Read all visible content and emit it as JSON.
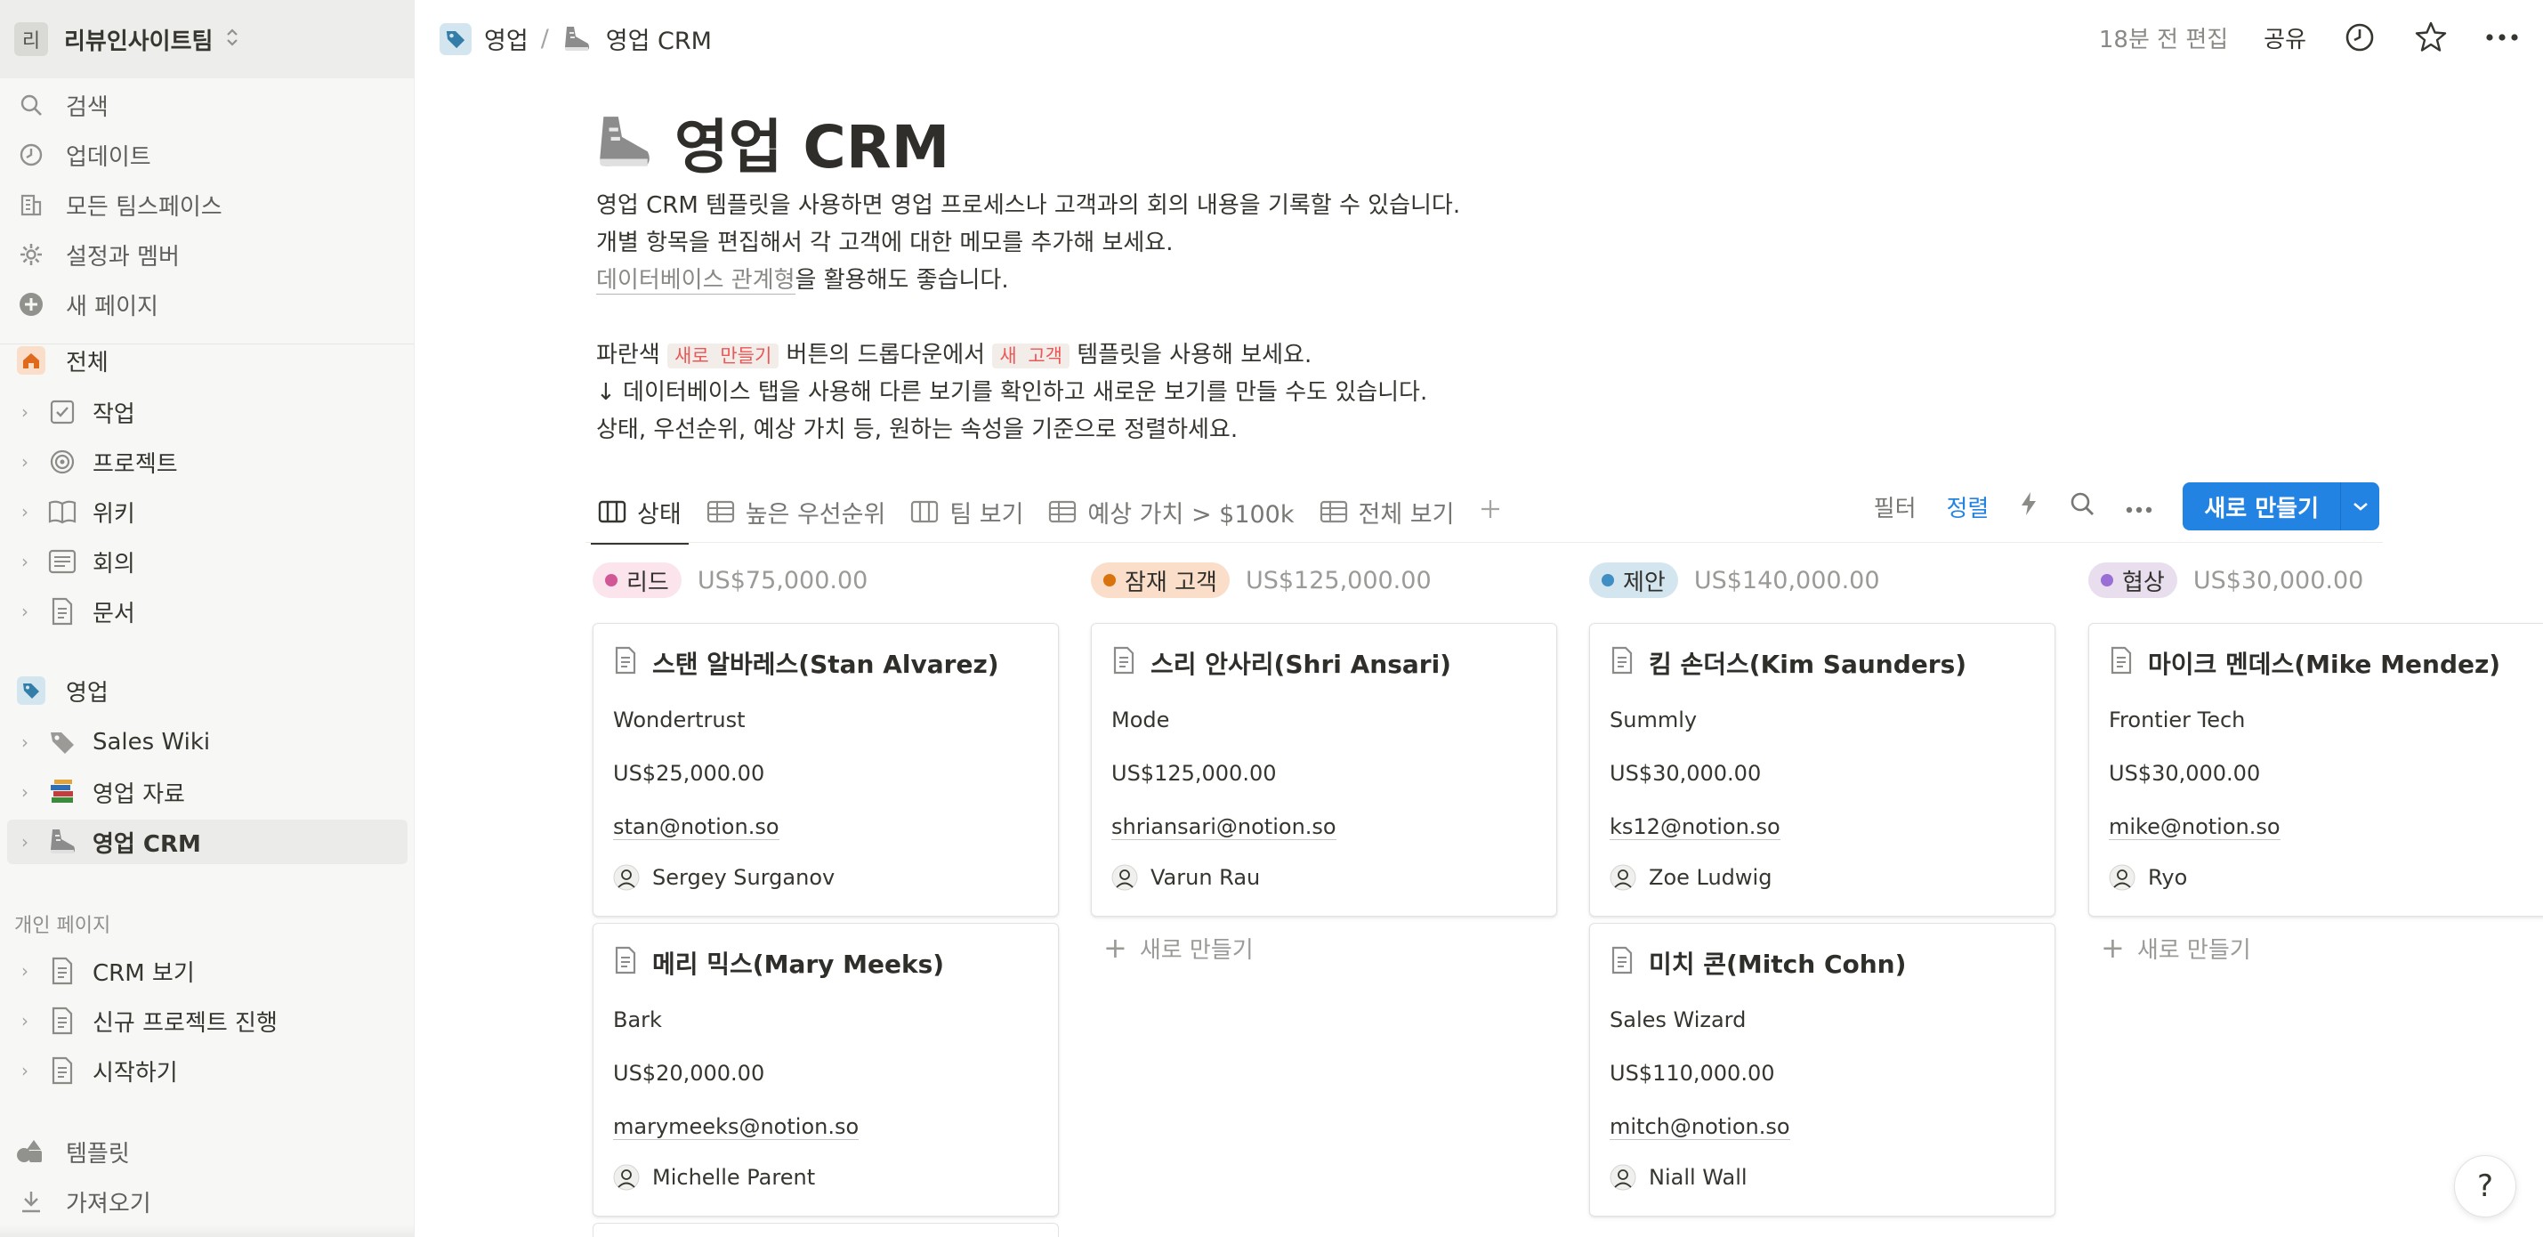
{
  "workspace": {
    "avatar": "리",
    "name": "리뷰인사이트팀"
  },
  "sidebar": {
    "top": [
      {
        "label": "검색",
        "icon": "search-icon"
      },
      {
        "label": "업데이트",
        "icon": "clock-icon"
      },
      {
        "label": "모든 팀스페이스",
        "icon": "building-icon"
      },
      {
        "label": "설정과 멤버",
        "icon": "gear-icon"
      },
      {
        "label": "새 페이지",
        "icon": "plus-circle-icon"
      }
    ],
    "teamspace_all": {
      "label": "전체",
      "icon": "home-icon"
    },
    "all_items": [
      {
        "label": "작업",
        "icon": "checkbox-icon"
      },
      {
        "label": "프로젝트",
        "icon": "target-icon"
      },
      {
        "label": "위키",
        "icon": "book-icon"
      },
      {
        "label": "회의",
        "icon": "notes-icon"
      },
      {
        "label": "문서",
        "icon": "document-icon"
      }
    ],
    "teamspace_sales": {
      "label": "영업",
      "icon": "tag-icon"
    },
    "sales_items": [
      {
        "label": "Sales Wiki",
        "icon": "tag-icon"
      },
      {
        "label": "영업 자료",
        "icon": "books-icon"
      },
      {
        "label": "영업 CRM",
        "icon": "shoe-icon"
      }
    ],
    "personal_section": "개인 페이지",
    "personal_items": [
      {
        "label": "CRM 보기",
        "icon": "document-icon"
      },
      {
        "label": "신규 프로젝트 진행",
        "icon": "document-icon"
      },
      {
        "label": "시작하기",
        "icon": "document-icon"
      }
    ],
    "bottom": [
      {
        "label": "템플릿",
        "icon": "shapes-icon"
      },
      {
        "label": "가져오기",
        "icon": "download-icon"
      }
    ]
  },
  "topbar": {
    "breadcrumb": [
      {
        "label": "영업"
      },
      {
        "label": "영업 CRM"
      }
    ],
    "separator": "/",
    "edited": "18분 전 편집",
    "share": "공유"
  },
  "page": {
    "title": "영업 CRM",
    "desc": {
      "line1": "영업 CRM 템플릿을 사용하면 영업 프로세스나 고객과의 회의 내용을 기록할 수 있습니다.",
      "line2": "개별 항목을 편집해서 각 고객에 대한 메모를 추가해 보세요.",
      "line3_link": "데이터베이스 관계형",
      "line3_rest": "을 활용해도 좋습니다.",
      "line4_a": "파란색 ",
      "line4_code1": "새로 만들기",
      "line4_b": " 버튼의 드롭다운에서 ",
      "line4_code2": "새 고객",
      "line4_c": " 템플릿을 사용해 보세요.",
      "line5": "↓ 데이터베이스 탭을 사용해 다른 보기를 확인하고 새로운 보기를 만들 수도 있습니다.",
      "line6": "상태, 우선순위, 예상 가치 등, 원하는 속성을 기준으로 정렬하세요."
    }
  },
  "views": {
    "tabs": [
      {
        "label": "상태",
        "icon": "board-icon"
      },
      {
        "label": "높은 우선순위",
        "icon": "table-icon"
      },
      {
        "label": "팀 보기",
        "icon": "board-icon"
      },
      {
        "label": "예상 가치 > $100k",
        "icon": "table-icon"
      },
      {
        "label": "전체 보기",
        "icon": "table-icon"
      }
    ],
    "filter": "필터",
    "sort": "정렬",
    "new_button": "새로 만들기"
  },
  "board": {
    "add_new": "새로 만들기",
    "columns": [
      {
        "status": "리드",
        "total": "US$75,000.00",
        "pill_bg": "#fbe4ec",
        "dot": "#d15796",
        "cards": [
          {
            "title": "스탠 알바레스(Stan Alvarez)",
            "company": "Wondertrust",
            "value": "US$25,000.00",
            "email": "stan@notion.so",
            "owner": "Sergey Surganov"
          },
          {
            "title": "메리 믹스(Mary Meeks)",
            "company": "Bark",
            "value": "US$20,000.00",
            "email": "marymeeks@notion.so",
            "owner": "Michelle Parent"
          }
        ]
      },
      {
        "status": "잠재 고객",
        "total": "US$125,000.00",
        "pill_bg": "#fadec9",
        "dot": "#d9730d",
        "cards": [
          {
            "title": "스리 안사리(Shri Ansari)",
            "company": "Mode",
            "value": "US$125,000.00",
            "email": "shriansari@notion.so",
            "owner": "Varun Rau"
          }
        ]
      },
      {
        "status": "제안",
        "total": "US$140,000.00",
        "pill_bg": "#d3e5ef",
        "dot": "#3f8ec4",
        "cards": [
          {
            "title": "킴 손더스(Kim Saunders)",
            "company": "Summly",
            "value": "US$30,000.00",
            "email": "ks12@notion.so",
            "owner": "Zoe Ludwig"
          },
          {
            "title": "미치 콘(Mitch Cohn)",
            "company": "Sales Wizard",
            "value": "US$110,000.00",
            "email": "mitch@notion.so",
            "owner": "Niall Wall"
          }
        ]
      },
      {
        "status": "협상",
        "total": "US$30,000.00",
        "pill_bg": "#e8deee",
        "dot": "#9a6dd7",
        "cards": [
          {
            "title": "마이크 멘데스(Mike Mendez)",
            "company": "Frontier Tech",
            "value": "US$30,000.00",
            "email": "mike@notion.so",
            "owner": "Ryo"
          }
        ]
      }
    ]
  },
  "help": "?"
}
